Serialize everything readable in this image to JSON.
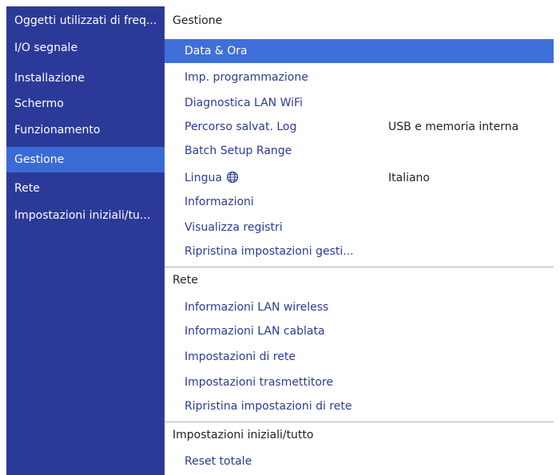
{
  "sidebar": {
    "items": [
      {
        "label": "Oggetti utilizzati di freq..."
      },
      {
        "label": "I/O segnale"
      },
      {
        "label": "Installazione"
      },
      {
        "label": "Schermo"
      },
      {
        "label": "Funzionamento"
      },
      {
        "label": "Gestione",
        "selected": true
      },
      {
        "label": "Rete"
      },
      {
        "label": "Impostazioni iniziali/tu..."
      }
    ]
  },
  "main": {
    "sections": [
      {
        "title": "Gestione",
        "rows": [
          {
            "label": "Data & Ora",
            "selected": true
          },
          {
            "label": "Imp. programmazione"
          },
          {
            "label": "Diagnostica LAN WiFi"
          },
          {
            "label": "Percorso salvat. Log",
            "value": "USB e memoria interna"
          },
          {
            "label": "Batch Setup Range"
          },
          {
            "label": "Lingua",
            "icon": "globe-icon",
            "value": "Italiano"
          },
          {
            "label": "Informazioni"
          },
          {
            "label": "Visualizza registri"
          },
          {
            "label": "Ripristina impostazioni gesti..."
          }
        ]
      },
      {
        "title": "Rete",
        "rows": [
          {
            "label": "Informazioni LAN wireless"
          },
          {
            "label": "Informazioni LAN cablata"
          },
          {
            "label": "Impostazioni di rete"
          },
          {
            "label": "Impostazioni trasmettitore"
          },
          {
            "label": "Ripristina impostazioni di rete"
          }
        ]
      },
      {
        "title": "Impostazioni iniziali/tutto",
        "rows": [
          {
            "label": "Reset totale"
          }
        ]
      }
    ]
  },
  "colors": {
    "sidebar_bg": "#2b3a98",
    "sidebar_selected": "#3a6ad6",
    "row_selected": "#3f6fd8",
    "item_text": "#2b3a98"
  }
}
